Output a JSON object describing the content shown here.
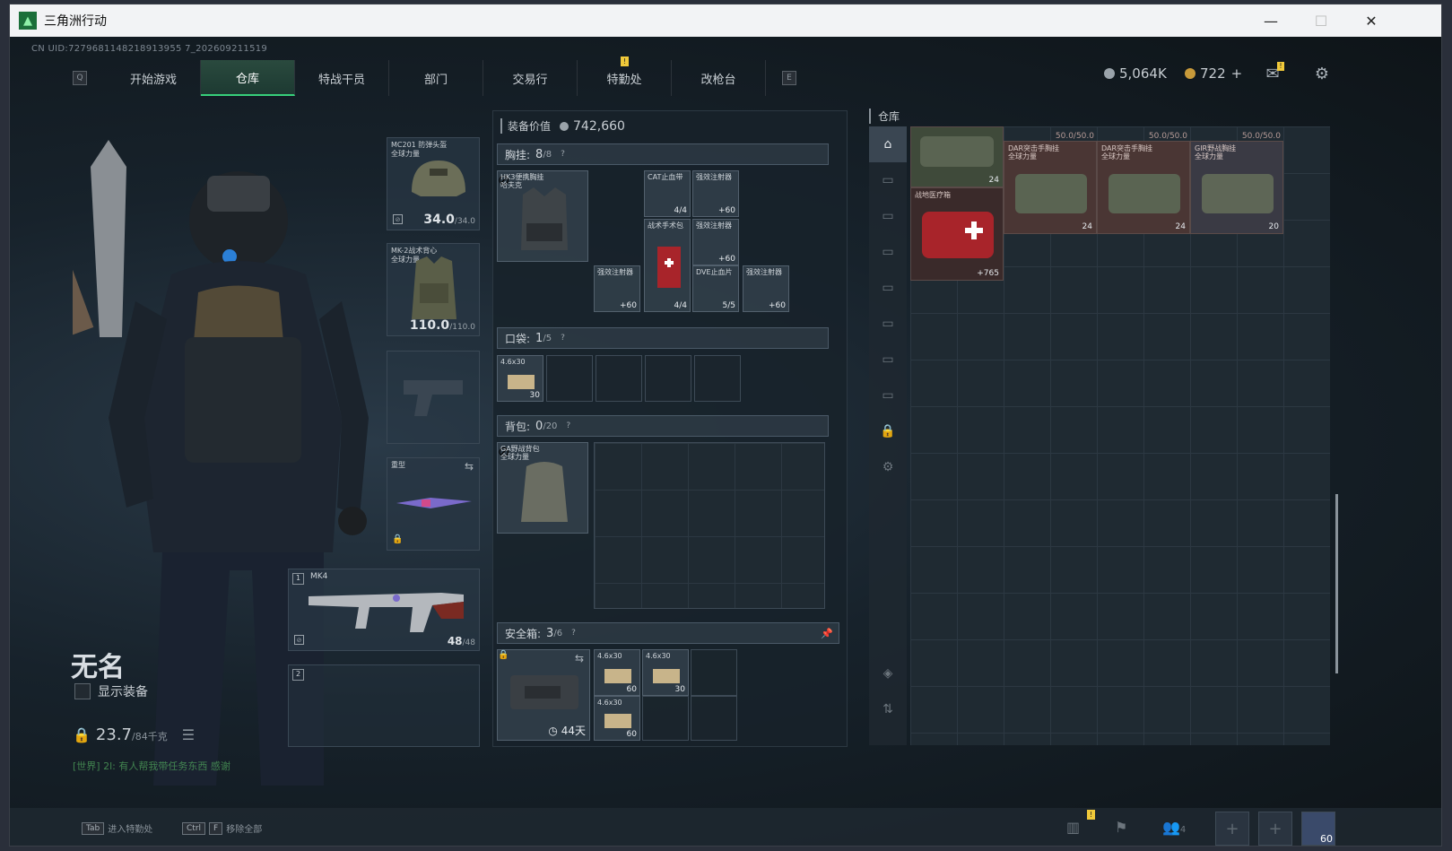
{
  "window": {
    "title": "三角洲行动",
    "minimize": "—",
    "maximize": "☐",
    "close": "✕"
  },
  "uid": "CN UID:7279681148218913955 7_202609211519",
  "nav": {
    "left_key": "Q",
    "right_key": "E",
    "tabs": [
      "开始游戏",
      "仓库",
      "特战干员",
      "部门",
      "交易行",
      "特勤处",
      "改枪台"
    ],
    "active": "仓库",
    "alert": "!"
  },
  "currency": {
    "silver": "5,064K",
    "gold": "722",
    "gold_add": "+"
  },
  "header_icons": {
    "mail": "mail-icon",
    "settings": "gear-icon",
    "mail_alert": "!"
  },
  "player": {
    "name": "无名",
    "show_gear": "显示装备",
    "weight": "23.7",
    "weight_max": "/84千克",
    "chat": "[世界] 2l: 有人帮我带任务东西 感谢"
  },
  "equipment": {
    "helmet": {
      "label1": "MC201 防弹头盔",
      "label2": "全球力量",
      "dur": "34.0",
      "max": "/34.0"
    },
    "armor": {
      "label1": "MK-2战术背心",
      "label2": "全球力量",
      "dur": "110.0",
      "max": "/110.0"
    },
    "melee": {
      "label": "重型"
    },
    "primary": {
      "slot": "1",
      "label": "MK4",
      "ammo": "48",
      "ammo_max": "/48"
    },
    "secondary": {
      "slot": "2"
    }
  },
  "center": {
    "value_label": "装备价值",
    "value": "742,660",
    "chest": {
      "title": "胸挂:",
      "used": "8",
      "cap": "/8",
      "rig": {
        "label1": "HK3便携胸挂",
        "label2": "哈夫克"
      }
    },
    "chest_items": [
      {
        "label": "CAT止血带",
        "cnt": "4/4"
      },
      {
        "label": "强效注射器",
        "cnt": "+60"
      },
      {
        "label": "战术手术包",
        "cnt": "4/4"
      },
      {
        "label": "强效注射器",
        "cnt": "+60"
      },
      {
        "label": "强效注射器",
        "cnt": "+60"
      },
      {
        "label": "DVE止血片",
        "cnt": "5/5"
      },
      {
        "label": "强效注射器",
        "cnt": "+60"
      }
    ],
    "pocket": {
      "title": "口袋:",
      "used": "1",
      "cap": "/5",
      "item": {
        "label": "4.6x30",
        "cnt": "30"
      }
    },
    "backpack": {
      "title": "背包:",
      "used": "0",
      "cap": "/20",
      "bag": {
        "label1": "GA野战背包",
        "label2": "全球力量"
      }
    },
    "safebox": {
      "title": "安全箱:",
      "used": "3",
      "cap": "/6",
      "time": "44天",
      "items": [
        {
          "label": "4.6x30",
          "cnt": "60"
        },
        {
          "label": "4.6x30",
          "cnt": "30"
        },
        {
          "label": "4.6x30",
          "cnt": "60"
        }
      ]
    }
  },
  "warehouse": {
    "title": "仓库",
    "items": [
      {
        "label": "",
        "cnt": "24",
        "top": ""
      },
      {
        "label": "DAR突击手胸挂",
        "label2": "全球力量",
        "cnt": "24",
        "top": "50.0/50.0"
      },
      {
        "label": "DAR突击手胸挂",
        "label2": "全球力量",
        "cnt": "24",
        "top": "50.0/50.0"
      },
      {
        "label": "GIR野战胸挂",
        "label2": "全球力量",
        "cnt": "20",
        "top": "50.0/50.0"
      },
      {
        "label": "战地医疗箱",
        "cnt": "+765",
        "top": ""
      }
    ]
  },
  "bottom": {
    "hint1_key": "Tab",
    "hint1": "进入特勤处",
    "hint2_key1": "Ctrl",
    "hint2_key2": "F",
    "hint2": "移除全部",
    "team": "4",
    "level": "60",
    "alert": "!"
  },
  "colors": {
    "accent": "#37d07b",
    "active_tab": "#2a4a3e",
    "warehouse_item": "#4a3634",
    "alert": "#f0c93a"
  }
}
